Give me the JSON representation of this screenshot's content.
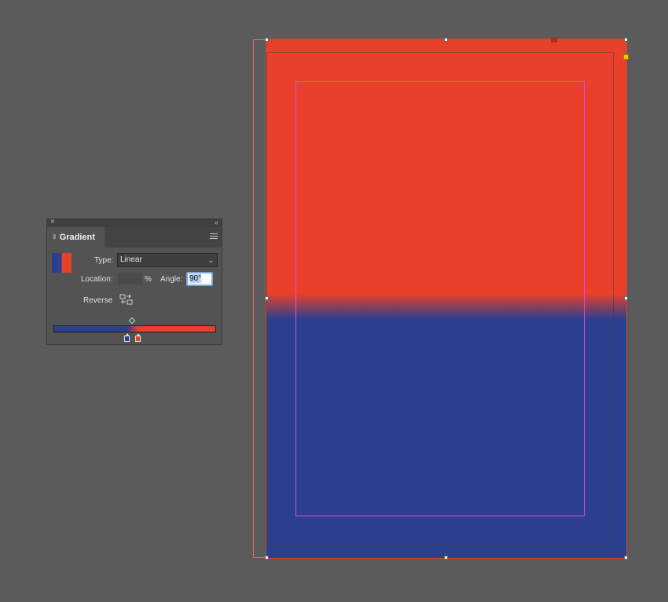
{
  "panel": {
    "title": "Gradient",
    "close_glyph": "×",
    "collapse_glyph": "‹‹",
    "type_label": "Type:",
    "type_value": "Linear",
    "location_label": "Location:",
    "location_value": "",
    "location_unit": "%",
    "angle_label": "Angle:",
    "angle_value": "90°",
    "reverse_label": "Reverse",
    "icons": [
      "close-icon",
      "collapse-icon",
      "panel-menu-icon",
      "reverse-gradient-icon",
      "midpoint-diamond-icon"
    ],
    "stops": [
      {
        "color": "#2b3f8f"
      },
      {
        "color": "#e8402a"
      }
    ]
  },
  "document": {
    "colors": {
      "top": "#e8402a",
      "bottom": "#2b3f8f",
      "margin_guide": "#e04ce0"
    }
  }
}
